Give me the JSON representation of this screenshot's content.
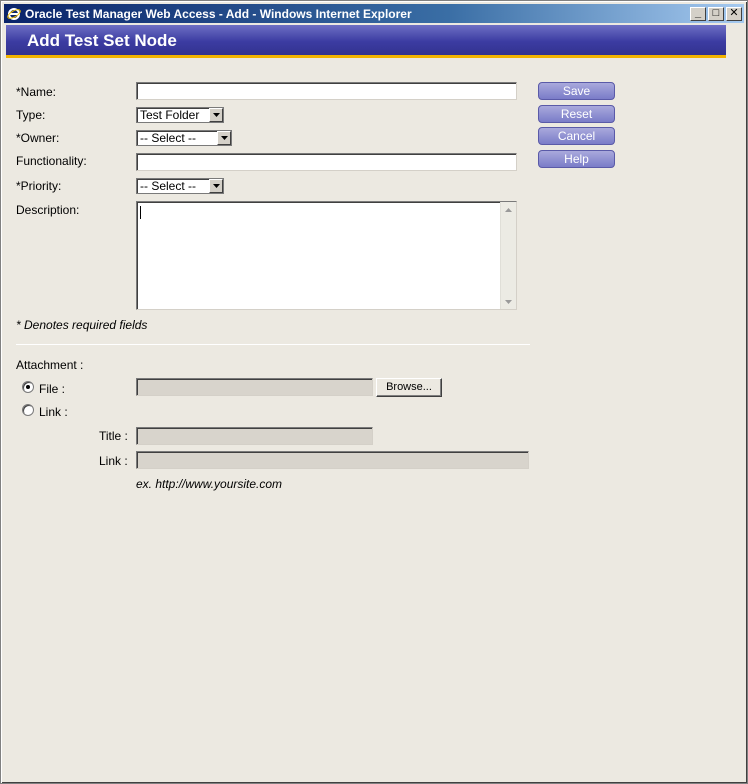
{
  "window": {
    "title": "Oracle Test Manager Web Access - Add - Windows Internet Explorer",
    "controls": {
      "minimize": "_",
      "maximize": "□",
      "close": "✕"
    }
  },
  "header": {
    "title": "Add Test Set Node"
  },
  "form": {
    "name_label": "*Name:",
    "name_value": "",
    "type_label": "Type:",
    "type_value": "Test Folder",
    "owner_label": "*Owner:",
    "owner_value": "-- Select --",
    "functionality_label": "Functionality:",
    "functionality_value": "",
    "priority_label": "*Priority:",
    "priority_value": "-- Select --",
    "description_label": "Description:",
    "required_note": "* Denotes required fields"
  },
  "actions": {
    "save": "Save",
    "reset": "Reset",
    "cancel": "Cancel",
    "help": "Help"
  },
  "attachment": {
    "label": "Attachment :",
    "file_label": "File :",
    "file_selected": true,
    "browse_label": "Browse...",
    "link_option_label": "Link :",
    "link_selected": false,
    "title_label": "Title :",
    "link_label": "Link :",
    "example": "ex. http://www.yoursite.com"
  },
  "icons": {
    "window_icon": "internet-explorer-icon",
    "dropdown": "chevron-down-icon",
    "scroll_up": "scroll-up-icon",
    "scroll_down": "scroll-down-icon"
  },
  "colors": {
    "header_bg": "#3c3ca2",
    "header_accent": "#f2b300",
    "button_bg": "#7a7cc8"
  }
}
